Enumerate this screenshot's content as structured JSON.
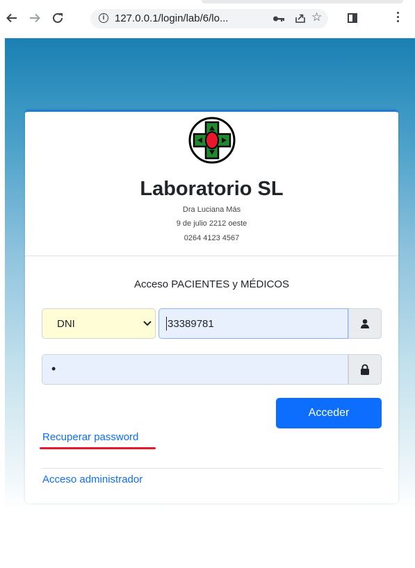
{
  "browser": {
    "url": "127.0.0.1/login/lab/6/lo...",
    "icons": [
      "back-icon",
      "forward-icon",
      "reload-icon",
      "info-icon",
      "key-icon",
      "share-icon",
      "star-icon",
      "tab-search-icon",
      "menu-icon"
    ]
  },
  "header": {
    "lab_name": "Laboratorio SL",
    "doctor": "Dra Luciana Más",
    "address": "9 de julio 2212 oeste",
    "phone": "0264 4123 4567"
  },
  "form": {
    "title": "Acceso PACIENTES y MÉDICOS",
    "doc_type": "DNI",
    "doc_number": "33389781",
    "password_mask": "•",
    "submit_label": "Acceder"
  },
  "links": {
    "recover": "Recuperar password",
    "admin": "Acceso administrador"
  },
  "colors": {
    "brand_top": "#1a80b4",
    "primary": "#0d6efd",
    "highlight": "#e8172b",
    "logo_green": "#1f8a2e",
    "logo_red": "#e8172b"
  }
}
